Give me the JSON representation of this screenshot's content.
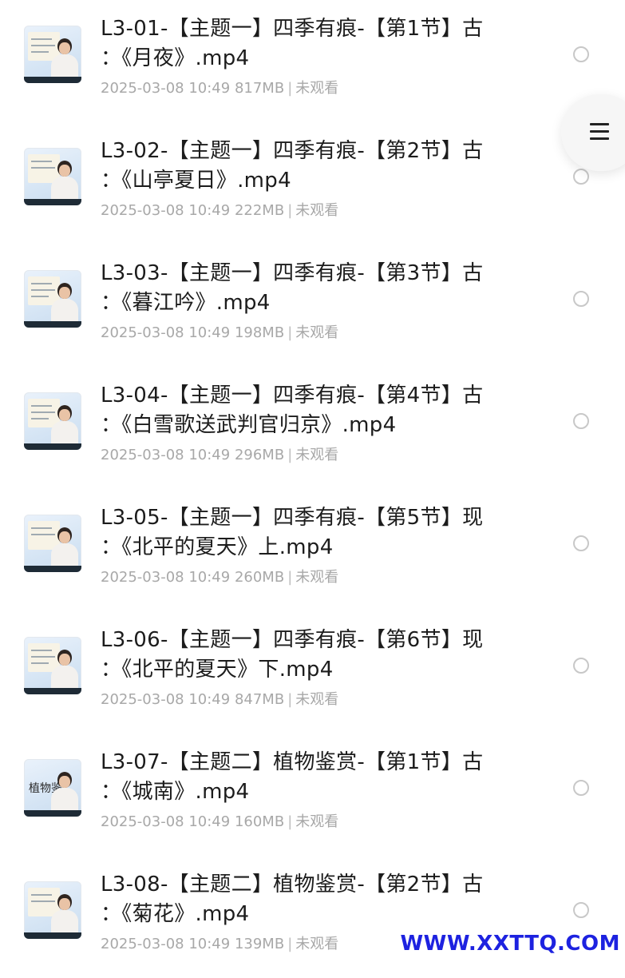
{
  "items": [
    {
      "title_line1": "L3-01-【主题一】四季有痕-【第1节】古",
      "title_line2": "：《月夜》.mp4",
      "date": "2025-03-08 10:49",
      "size": "817MB",
      "status": "未观看"
    },
    {
      "title_line1": "L3-02-【主题一】四季有痕-【第2节】古",
      "title_line2": "：《山亭夏日》.mp4",
      "date": "2025-03-08 10:49",
      "size": "222MB",
      "status": "未观看"
    },
    {
      "title_line1": "L3-03-【主题一】四季有痕-【第3节】古",
      "title_line2": "：《暮江吟》.mp4",
      "date": "2025-03-08 10:49",
      "size": "198MB",
      "status": "未观看"
    },
    {
      "title_line1": "L3-04-【主题一】四季有痕-【第4节】古",
      "title_line2": "：《白雪歌送武判官归京》.mp4",
      "date": "2025-03-08 10:49",
      "size": "296MB",
      "status": "未观看"
    },
    {
      "title_line1": "L3-05-【主题一】四季有痕-【第5节】现",
      "title_line2": "：《北平的夏天》上.mp4",
      "date": "2025-03-08 10:49",
      "size": "260MB",
      "status": "未观看"
    },
    {
      "title_line1": "L3-06-【主题一】四季有痕-【第6节】现",
      "title_line2": "：《北平的夏天》下.mp4",
      "date": "2025-03-08 10:49",
      "size": "847MB",
      "status": "未观看"
    },
    {
      "title_line1": "L3-07-【主题二】植物鉴赏-【第1节】古",
      "title_line2": "：《城南》.mp4",
      "date": "2025-03-08 10:49",
      "size": "160MB",
      "status": "未观看",
      "thumb_text": "植物鉴"
    },
    {
      "title_line1": "L3-08-【主题二】植物鉴赏-【第2节】古",
      "title_line2": "：《菊花》.mp4",
      "date": "2025-03-08 10:49",
      "size": "139MB",
      "status": "未观看"
    }
  ],
  "separator": "|",
  "menu": {
    "icon": "hamburger-menu-icon"
  },
  "watermark": "WWW.XXTTQ.COM",
  "colors": {
    "title": "#1c1c1c",
    "meta": "#a8a8a8",
    "radio_border": "#c8c8c8",
    "watermark": "#1d22e0"
  }
}
